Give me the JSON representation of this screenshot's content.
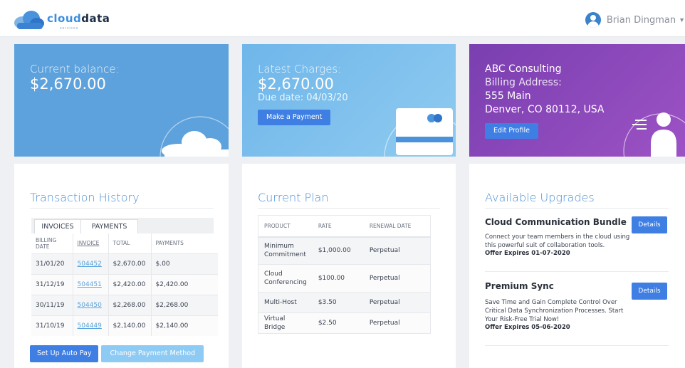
{
  "header": {
    "logo_word_a": "cloud",
    "logo_word_b": "data",
    "logo_sub": "services",
    "user_name": "Brian Dingman"
  },
  "balance": {
    "label": "Current balance:",
    "amount": "$2,670.00"
  },
  "charges": {
    "label": "Latest Charges:",
    "amount": "$2,670.00",
    "due_label": "Due date:",
    "due_date": "04/03/20",
    "pay_button": "Make a Payment"
  },
  "profile": {
    "company": "ABC Consulting",
    "billing_label": "Billing Address:",
    "street": "555 Main",
    "city": "Denver, CO 80112, USA",
    "edit_button": "Edit Profile"
  },
  "transactions": {
    "title": "Transaction History",
    "tabs": [
      "INVOICES",
      "PAYMENTS"
    ],
    "columns": [
      "BILLING DATE",
      "INVOICE",
      "TOTAL",
      "PAYMENTS"
    ],
    "rows": [
      [
        "31/01/20",
        "504452",
        "$2,670.00",
        "$.00"
      ],
      [
        "31/12/19",
        "504451",
        "$2,420.00",
        "$2,420.00"
      ],
      [
        "30/11/19",
        "504450",
        "$2,268.00",
        "$2,268.00"
      ],
      [
        "31/10/19",
        "504449",
        "$2,140.00",
        "$2,140.00"
      ]
    ],
    "autopay_button": "Set Up Auto Pay",
    "change_method_button": "Change Payment Method"
  },
  "plan": {
    "title": "Current Plan",
    "columns": [
      "PRODUCT",
      "RATE",
      "RENEWAL DATE"
    ],
    "rows": [
      [
        "Minimum Commitment",
        "$1,000.00",
        "Perpetual"
      ],
      [
        "Cloud Conferencing",
        "$100.00",
        "Perpetual"
      ],
      [
        "Multi-Host",
        "$3.50",
        "Perpetual"
      ],
      [
        "Virtual Bridge",
        "$2.50",
        "Perpetual"
      ]
    ]
  },
  "upgrades": {
    "title": "Available Upgrades",
    "items": [
      {
        "name": "Cloud Communication Bundle",
        "desc": "Connect your team members in the cloud using this powerful suit of collaboration tools.",
        "expires": "Offer Expires 01-07-2020",
        "button": "Details"
      },
      {
        "name": "Premium Sync",
        "desc": "Save Time and Gain Complete Control Over Critical Data Synchronization Processes. Start Your Risk-Free Trial Now!",
        "expires": "Offer Expires 05-06-2020",
        "button": "Details"
      }
    ]
  },
  "colors": {
    "accent_blue": "#3f7fe3",
    "title_blue": "#4a8fd4",
    "purple": "#8a48bb",
    "sky": "#5da2dc"
  }
}
